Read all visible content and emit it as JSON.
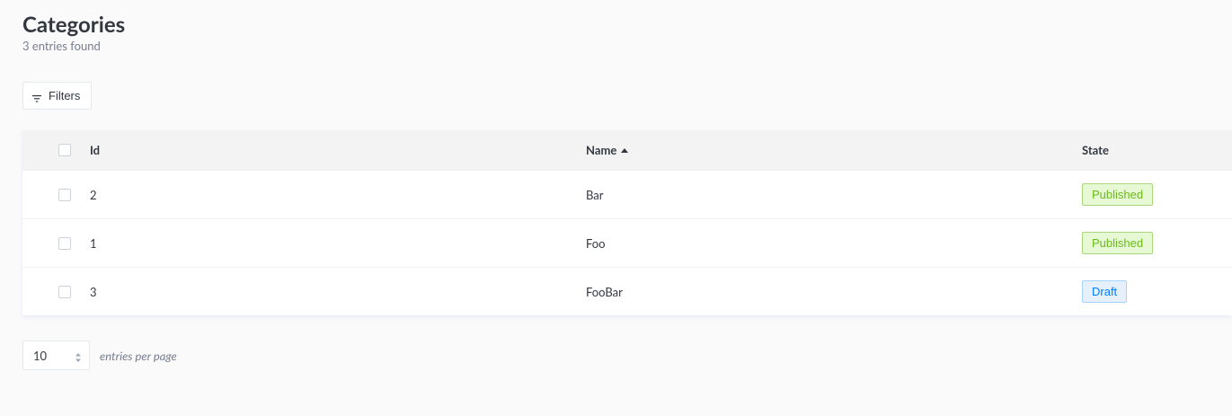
{
  "header": {
    "title": "Categories",
    "count_text": "3 entries found"
  },
  "toolbar": {
    "filters_label": "Filters"
  },
  "table": {
    "columns": {
      "id": "Id",
      "name": "Name",
      "state": "State"
    },
    "sort": {
      "column": "Name",
      "direction": "ascending"
    },
    "rows": [
      {
        "id": "2",
        "name": "Bar",
        "state": "Published"
      },
      {
        "id": "1",
        "name": "Foo",
        "state": "Published"
      },
      {
        "id": "3",
        "name": "FooBar",
        "state": "Draft"
      }
    ]
  },
  "pagination": {
    "page_size": "10",
    "per_page_label": "entries per page"
  },
  "icons": {
    "filter": "filter-icon",
    "sort": "sort-ascending-icon",
    "stepper": "stepper-icon"
  },
  "colors": {
    "published_text": "#6dbb1a",
    "published_bg": "#e6f8d4",
    "draft_text": "#007eff",
    "draft_bg": "#e6f0fb"
  }
}
